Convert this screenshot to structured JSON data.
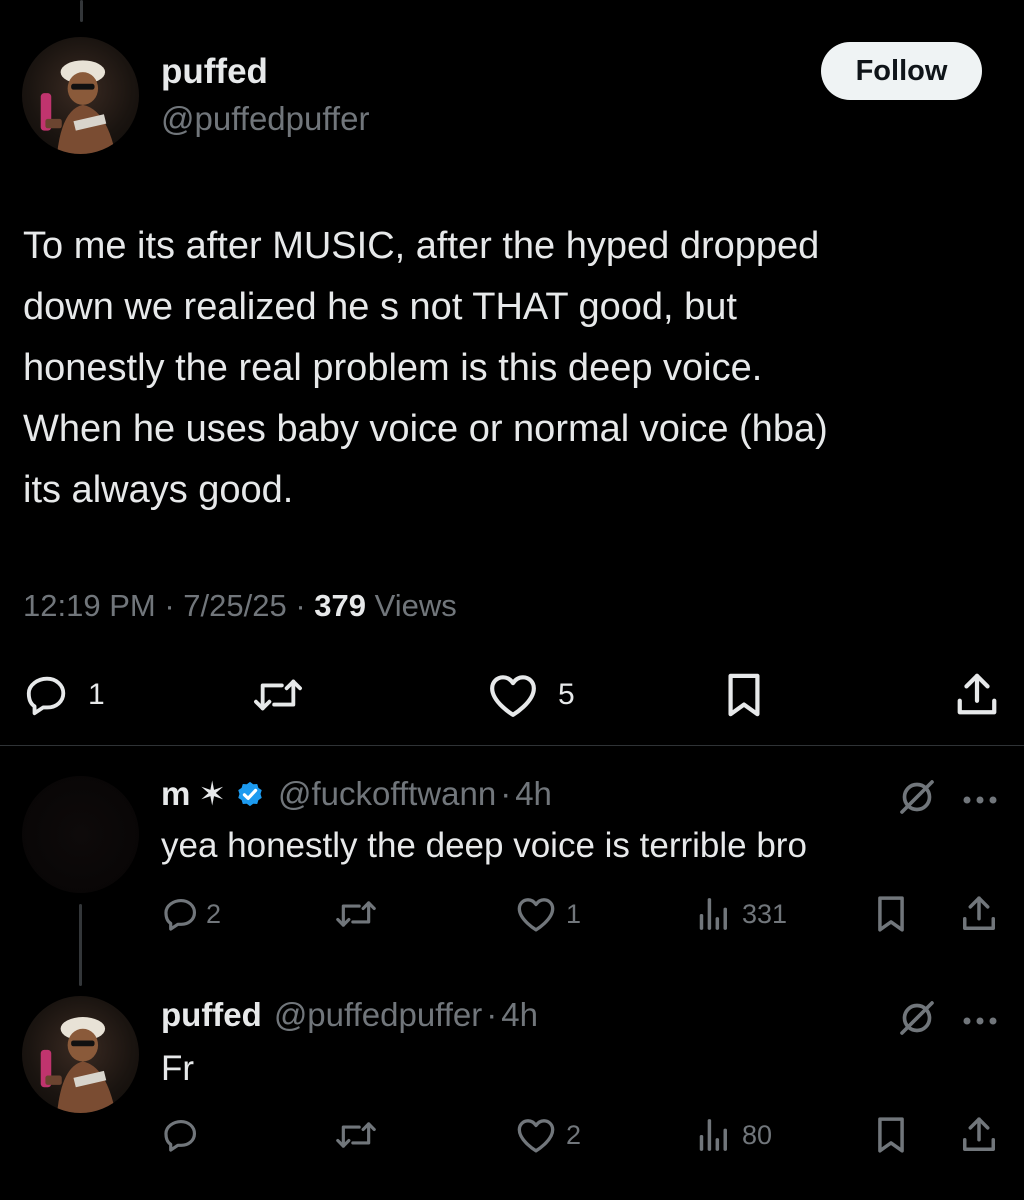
{
  "main_tweet": {
    "author": {
      "name": "puffed",
      "handle": "@puffedpuffer"
    },
    "follow_label": "Follow",
    "text_lines": [
      "To me its after MUSIC, after the hyped dropped",
      "down we realized he s not THAT good, but",
      "honestly the real problem is this deep voice.",
      "When he uses baby voice or normal voice (hba)",
      "its always good."
    ],
    "time": "12:19 PM",
    "date": "7/25/25",
    "views_count": "379",
    "views_label": "Views",
    "actions": {
      "reply_count": "1",
      "repost_count": "",
      "like_count": "5"
    }
  },
  "replies": [
    {
      "name": "m",
      "name_symbol": "✶",
      "verified": true,
      "handle": "@fuckofftwann",
      "time": "4h",
      "text": "yea honestly the deep voice is terrible bro",
      "actions": {
        "reply_count": "2",
        "repost_count": "",
        "like_count": "1",
        "views_count": "331"
      }
    },
    {
      "name": "puffed",
      "handle": "@puffedpuffer",
      "time": "4h",
      "text": "Fr",
      "actions": {
        "reply_count": "",
        "repost_count": "",
        "like_count": "2",
        "views_count": "80"
      }
    }
  ],
  "separator": "·",
  "colors": {
    "background": "#000000",
    "text": "#e7e9ea",
    "muted": "#71767b",
    "verified": "#1d9bf0",
    "follow_bg": "#eff3f4"
  },
  "icons": [
    "reply-icon",
    "repost-icon",
    "like-icon",
    "bookmark-icon",
    "share-icon",
    "views-icon",
    "grok-icon",
    "more-icon",
    "verified-icon"
  ]
}
